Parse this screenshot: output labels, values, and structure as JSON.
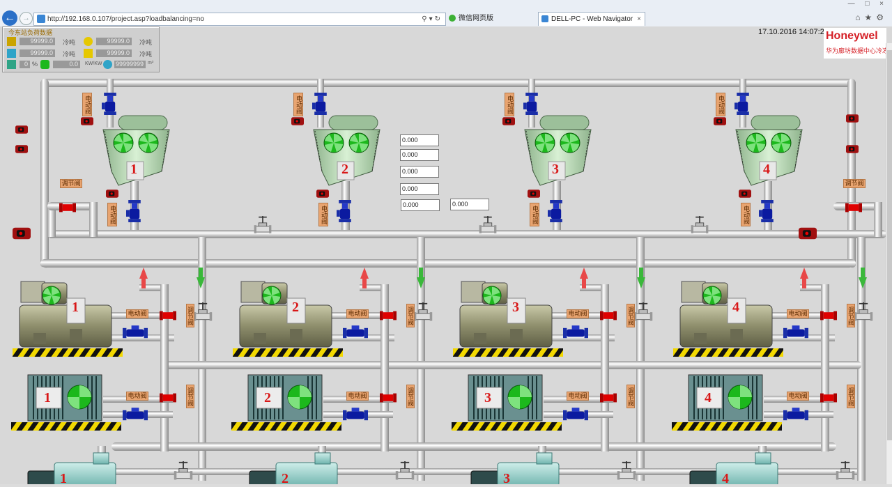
{
  "browser": {
    "url": "http://192.168.0.107/project.asp?loadbalancing=no",
    "tabs": [
      {
        "label": "微信网页版"
      },
      {
        "label": "DELL-PC - Web Navigator"
      }
    ]
  },
  "header": {
    "datetime": "17.10.2016 14:07:2",
    "brand": "Honeywel",
    "subtitle": "华为廊坊数据中心冷冻"
  },
  "summary_panel": {
    "title": "今东站负荷数据",
    "rows": [
      [
        {
          "value": "99999.0",
          "unit": "冷吨"
        },
        {
          "value": "99999.0",
          "unit": "冷吨"
        }
      ],
      [
        {
          "value": "99999.0",
          "unit": "冷吨"
        },
        {
          "value": "99999.0",
          "unit": "冷吨"
        }
      ]
    ],
    "row3": {
      "v1": "0",
      "u1": "%",
      "v2": "0.0",
      "u2": "KW/KW",
      "v3": "99999999",
      "u3": "m³"
    }
  },
  "fields": [
    "0.000",
    "0.000",
    "0.000",
    "0.000",
    "0.000",
    "0.000"
  ],
  "valve_labels": {
    "motor": "电动阀",
    "reg": "调节阀"
  },
  "towers": [
    "1",
    "2",
    "3",
    "4"
  ],
  "chillers": [
    "1",
    "2",
    "3",
    "4"
  ],
  "exchangers": [
    "1",
    "2",
    "3",
    "4"
  ],
  "pumps": [
    "1",
    "2",
    "3",
    "4"
  ]
}
